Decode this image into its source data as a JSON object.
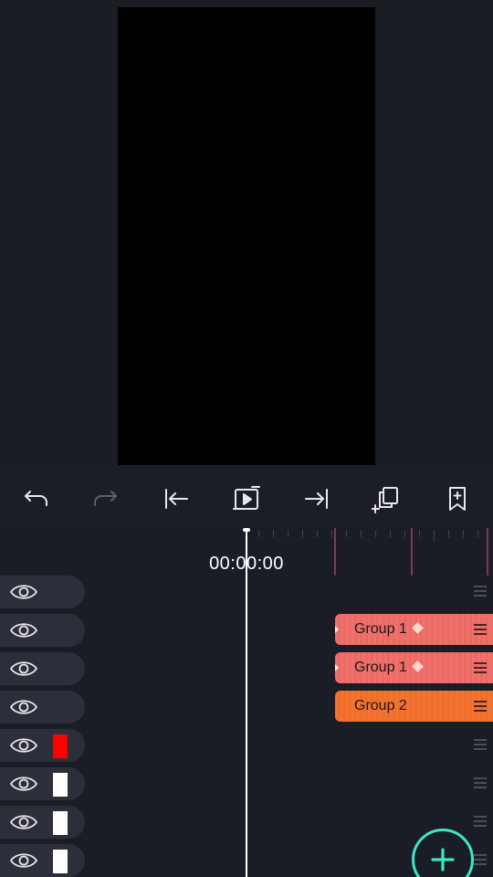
{
  "toolbar": {
    "buttons": [
      {
        "name": "undo-icon",
        "enabled": true
      },
      {
        "name": "redo-icon",
        "enabled": false
      },
      {
        "name": "jump-to-start-icon",
        "enabled": true
      },
      {
        "name": "play-preview-icon",
        "enabled": true
      },
      {
        "name": "jump-to-end-icon",
        "enabled": true
      },
      {
        "name": "duplicate-frame-icon",
        "enabled": true
      },
      {
        "name": "add-bookmark-icon",
        "enabled": true
      }
    ]
  },
  "timeline": {
    "current_time": "00:00:00"
  },
  "tracks": [
    {
      "swatch": null,
      "clip": null
    },
    {
      "swatch": null,
      "clip": {
        "label": "Group 1",
        "style": "salmon",
        "keyframe": true
      }
    },
    {
      "swatch": null,
      "clip": {
        "label": "Group 1",
        "style": "salmon",
        "keyframe": true
      }
    },
    {
      "swatch": null,
      "clip": {
        "label": "Group 2",
        "style": "orange",
        "keyframe": false
      }
    },
    {
      "swatch": "#ff0000",
      "clip": null
    },
    {
      "swatch": "#ffffff",
      "clip": null
    },
    {
      "swatch": "#ffffff",
      "clip": null
    },
    {
      "swatch": "#ffffff",
      "clip": null
    }
  ],
  "colors": {
    "accent": "#3ee6c3",
    "clip_salmon": "#f0706a",
    "clip_orange": "#f47330",
    "marker": "#7c3a4b"
  }
}
